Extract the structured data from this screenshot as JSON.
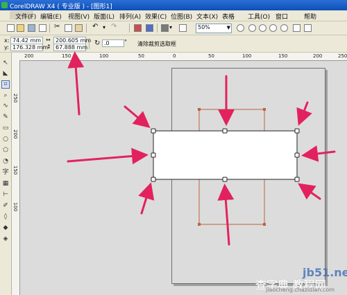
{
  "window": {
    "title": "CorelDRAW X4 ( 专业版 ) - [图形1]"
  },
  "menu": [
    "文件(F)",
    "编辑(E)",
    "视图(V)",
    "版面(L)",
    "排列(A)",
    "效果(C)",
    "位图(B)",
    "文本(X)",
    "表格",
    "工具(O)",
    "窗口",
    "帮助"
  ],
  "toolbar": {
    "zoom_value": "50%"
  },
  "property_bar": {
    "x_label": "x:",
    "x_value": "74.42 mm",
    "y_label": "y:",
    "y_value": "176.328 mm",
    "width_value": "200.605 mm",
    "height_value": "67.888 mm",
    "rotation_value": ".0",
    "rotation_unit": "°",
    "action_label": "清除裁剪选取框"
  },
  "ruler": {
    "h_labels": [
      "200",
      "150",
      "100",
      "50",
      "0",
      "50",
      "100",
      "150",
      "200",
      "250"
    ],
    "v_labels": [
      "250",
      "200",
      "150",
      "100"
    ]
  },
  "watermark": {
    "site": "jb51.net",
    "brand": "查字典 教程网",
    "url": "jiaocheng.chazidian.com"
  },
  "colors": {
    "arrow": "#e2225e",
    "crop_frame": "#b8653a",
    "page_bg": "#dcdcdc"
  }
}
